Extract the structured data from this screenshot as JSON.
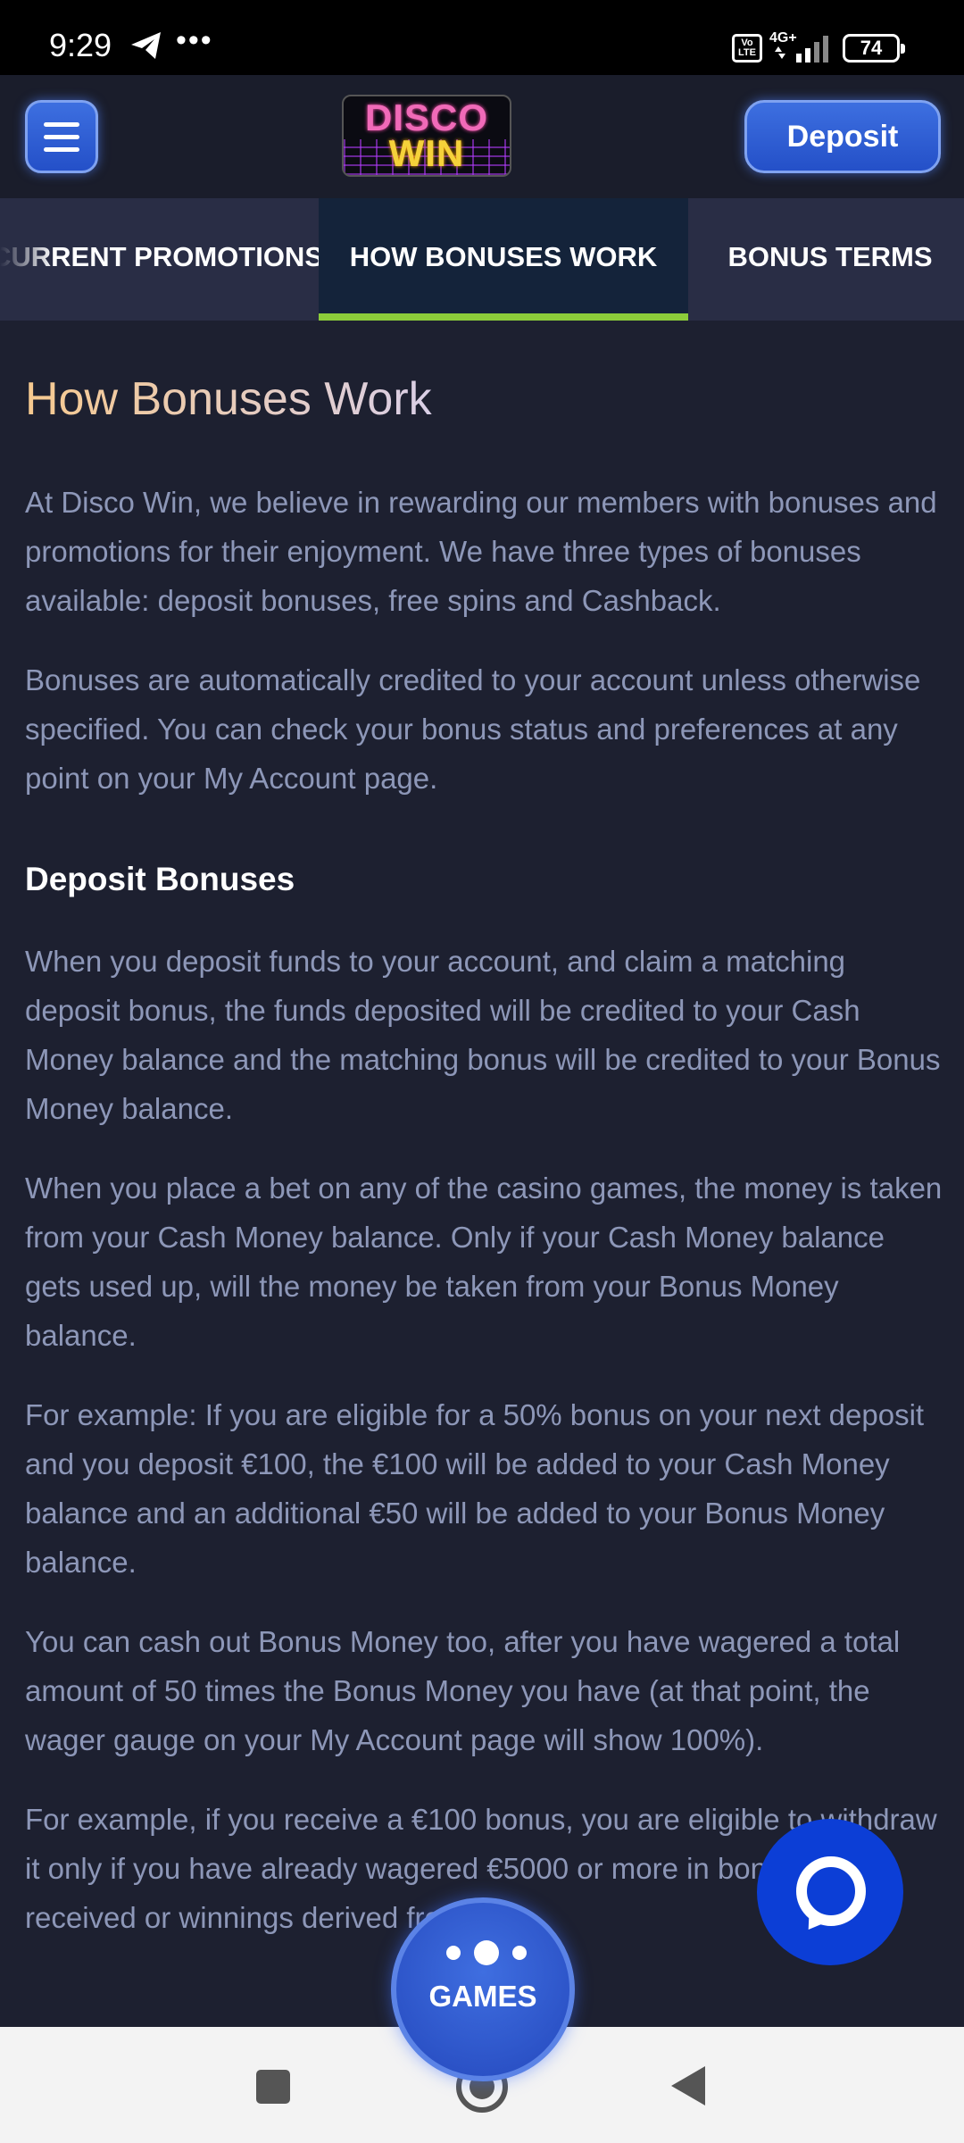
{
  "status_bar": {
    "time": "9:29",
    "dots": "•••",
    "volte": "Vo LTE",
    "network": "4G+",
    "battery": "74"
  },
  "header": {
    "logo_line1": "DISCO",
    "logo_line2": "WIN",
    "deposit_label": "Deposit"
  },
  "tabs": [
    {
      "label": "CURRENT PROMOTIONS",
      "active": false
    },
    {
      "label": "HOW BONUSES WORK",
      "active": true
    },
    {
      "label": "BONUS TERMS",
      "active": false
    }
  ],
  "content": {
    "title": "How Bonuses Work",
    "intro_paragraphs": [
      "At Disco Win, we believe in rewarding our members with bonuses and promotions for their enjoyment. We have three types of bonuses available: deposit bonuses, free spins and Cashback.",
      "Bonuses are automatically credited to your account unless otherwise specified. You can check your bonus status and preferences at any point on your My Account page."
    ],
    "deposit_heading": "Deposit Bonuses",
    "deposit_paragraphs": [
      "When you deposit funds to your account, and claim a matching deposit bonus, the funds deposited will be credited to your Cash Money balance and the matching bonus will be credited to your Bonus Money balance.",
      "When you place a bet on any of the casino games, the money is taken from your Cash Money balance. Only if your Cash Money balance gets used up, will the money be taken from your Bonus Money balance.",
      "For example: If you are eligible for a 50% bonus on your next deposit and you deposit €100, the €100 will be added to your Cash Money balance and an additional €50 will be added to your Bonus Money balance.",
      "You can cash out Bonus Money too, after you have wagered a total amount of 50 times the Bonus Money you have (at that point, the wager gauge on your My Account page will show 100%).",
      "For example, if you receive a €100 bonus, you are eligible to withdraw it only if you have already wagered €5000 or more in bonus money received or winnings derived from it."
    ]
  },
  "games_button": {
    "label": "GAMES"
  },
  "icons": {
    "menu": "hamburger-menu-icon",
    "chat": "chat-bubble-icon",
    "telegram": "telegram-icon",
    "games": "dots-icon"
  },
  "colors": {
    "background": "#1d2030",
    "tab_bar": "#292d45",
    "active_tab": "#14233a",
    "active_underline": "#8ccc3a",
    "primary_blue": "#2f5fd8",
    "chat_blue": "#0c3ed6",
    "body_text": "#8d97b8"
  }
}
